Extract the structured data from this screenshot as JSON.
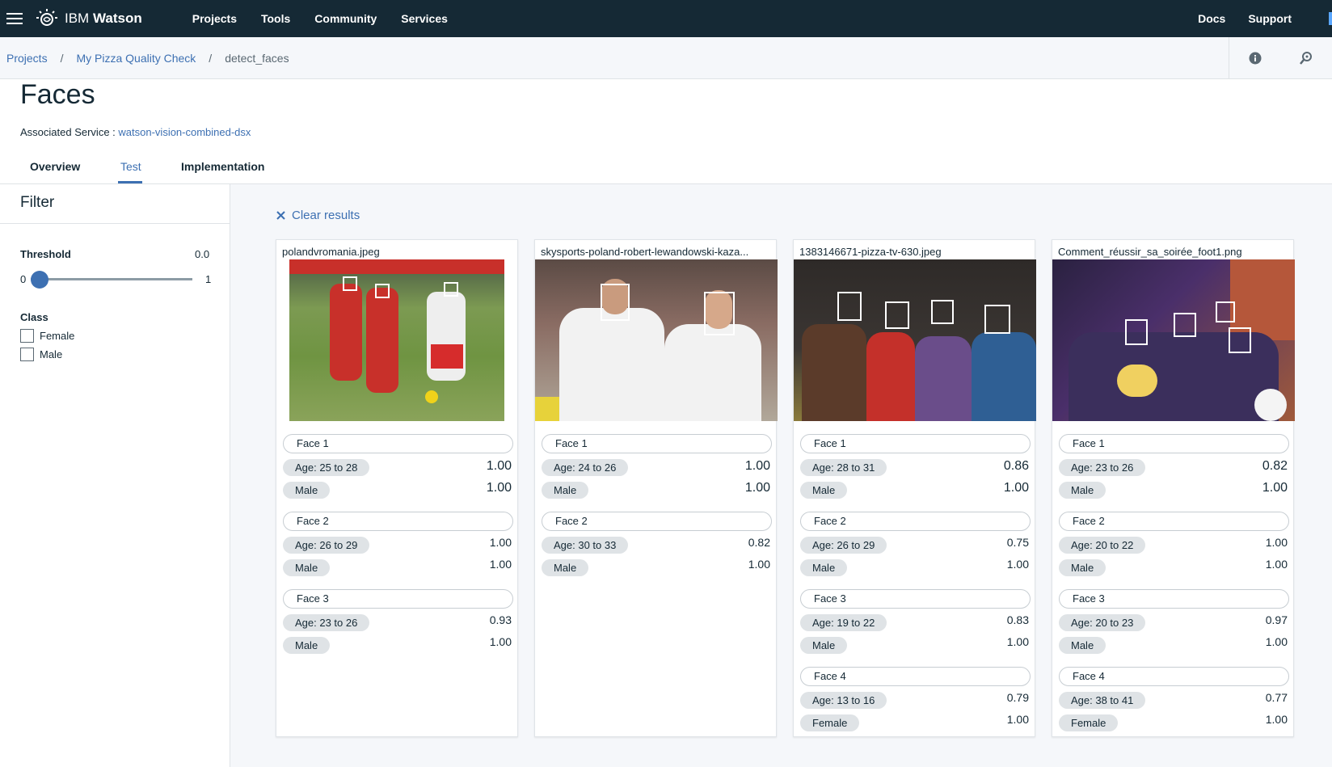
{
  "topnav": {
    "brand_ibm": "IBM",
    "brand_watson": "Watson",
    "items": [
      "Projects",
      "Tools",
      "Community",
      "Services"
    ],
    "right_items": [
      "Docs",
      "Support"
    ]
  },
  "breadcrumb": {
    "items": [
      "Projects",
      "My Pizza Quality Check",
      "detect_faces"
    ],
    "separator": "/"
  },
  "page": {
    "title": "Faces",
    "assoc_label": "Associated Service :",
    "assoc_link": "watson-vision-combined-dsx"
  },
  "tabs": [
    "Overview",
    "Test",
    "Implementation"
  ],
  "filter": {
    "title": "Filter",
    "threshold_label": "Threshold",
    "threshold_value": "0.0",
    "slider_min": "0",
    "slider_max": "1",
    "slider_level": 0.0,
    "class_label": "Class",
    "classes": [
      "Female",
      "Male"
    ]
  },
  "results": {
    "clear_label": "Clear results",
    "clear_icon": "close-icon",
    "cards": [
      {
        "filename": "polandvromania.jpeg",
        "faces": [
          {
            "label": "Face 1",
            "age": "Age: 25 to 28",
            "age_score": "1.00",
            "gender": "Male",
            "gender_score": "1.00"
          },
          {
            "label": "Face 2",
            "age": "Age: 26 to 29",
            "age_score": "1.00",
            "gender": "Male",
            "gender_score": "1.00"
          },
          {
            "label": "Face 3",
            "age": "Age: 23 to 26",
            "age_score": "0.93",
            "gender": "Male",
            "gender_score": "1.00"
          }
        ]
      },
      {
        "filename": "skysports-poland-robert-lewandowski-kaza...",
        "faces": [
          {
            "label": "Face 1",
            "age": "Age: 24 to 26",
            "age_score": "1.00",
            "gender": "Male",
            "gender_score": "1.00"
          },
          {
            "label": "Face 2",
            "age": "Age: 30 to 33",
            "age_score": "0.82",
            "gender": "Male",
            "gender_score": "1.00"
          }
        ]
      },
      {
        "filename": "1383146671-pizza-tv-630.jpeg",
        "faces": [
          {
            "label": "Face 1",
            "age": "Age: 28 to 31",
            "age_score": "0.86",
            "gender": "Male",
            "gender_score": "1.00"
          },
          {
            "label": "Face 2",
            "age": "Age: 26 to 29",
            "age_score": "0.75",
            "gender": "Male",
            "gender_score": "1.00"
          },
          {
            "label": "Face 3",
            "age": "Age: 19 to 22",
            "age_score": "0.83",
            "gender": "Male",
            "gender_score": "1.00"
          },
          {
            "label": "Face 4",
            "age": "Age: 13 to 16",
            "age_score": "0.79",
            "gender": "Female",
            "gender_score": "1.00"
          }
        ]
      },
      {
        "filename": "Comment_réussir_sa_soirée_foot1.png",
        "faces": [
          {
            "label": "Face 1",
            "age": "Age: 23 to 26",
            "age_score": "0.82",
            "gender": "Male",
            "gender_score": "1.00"
          },
          {
            "label": "Face 2",
            "age": "Age: 20 to 22",
            "age_score": "1.00",
            "gender": "Male",
            "gender_score": "1.00"
          },
          {
            "label": "Face 3",
            "age": "Age: 20 to 23",
            "age_score": "0.97",
            "gender": "Male",
            "gender_score": "1.00"
          },
          {
            "label": "Face 4",
            "age": "Age: 38 to 41",
            "age_score": "0.77",
            "gender": "Female",
            "gender_score": "1.00"
          }
        ]
      }
    ]
  },
  "colors": {
    "nav_bg": "#152935",
    "accent": "#3d70b2",
    "pill_bg": "#dfe3e6"
  }
}
